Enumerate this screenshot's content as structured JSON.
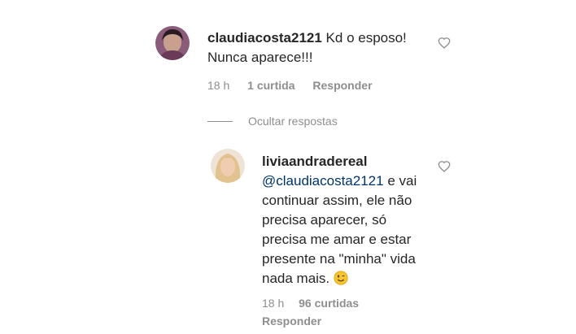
{
  "comment1": {
    "username": "claudiacosta2121",
    "text_line1": "Kd o esposo!",
    "text_line2": "Nunca aparece!!!",
    "time": "18 h",
    "likes": "1 curtida",
    "reply": "Responder",
    "heart_icon": "heart-outline-icon"
  },
  "replies_toggle": {
    "label": "Ocultar respostas"
  },
  "reply1": {
    "username": "liviaandradereal",
    "mention": "@claudiacosta2121",
    "text_after_mention": " e vai",
    "line2": "continuar assim, ele não",
    "line3": "precisa aparecer, só",
    "line4": "precisa me amar e estar",
    "line5": "presente na \"minha\" vida",
    "line6": "nada mais.",
    "emoji": "winking-face-emoji",
    "time": "18 h",
    "likes": "96 curtidas",
    "reply": "Responder",
    "heart_icon": "heart-outline-icon"
  }
}
